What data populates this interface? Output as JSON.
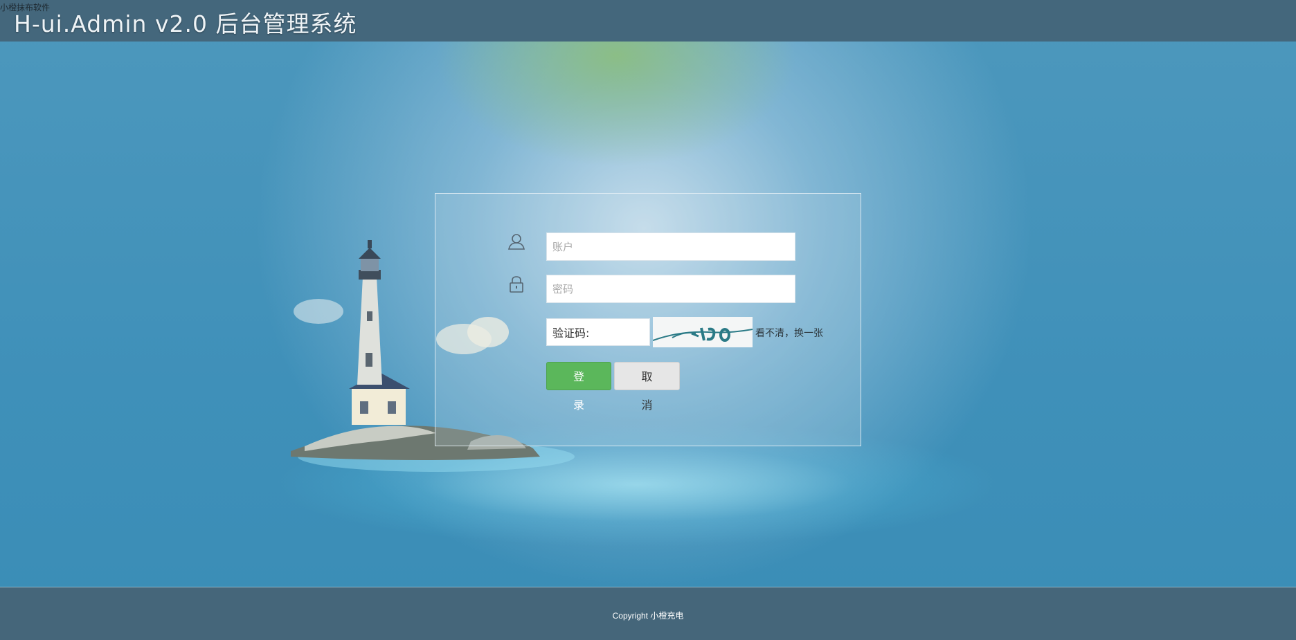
{
  "corner_text": "小橙抹布软件",
  "header": {
    "title": "H-ui.Admin v2.0 后台管理系统"
  },
  "form": {
    "account_placeholder": "账户",
    "password_placeholder": "密码",
    "captcha_value": "验证码:",
    "captcha_refresh_link": "看不清，换一张",
    "login_button": "登 录",
    "cancel_button": "取 消",
    "icons": [
      "user-icon",
      "lock-icon"
    ]
  },
  "footer": {
    "copyright": "Copyright 小橙充电"
  },
  "colors": {
    "header_bg": "#44677c",
    "footer_bg": "#45667a",
    "login_button": "#5bb75b",
    "cancel_button": "#e6e6e6",
    "background": "#2f86b0"
  }
}
